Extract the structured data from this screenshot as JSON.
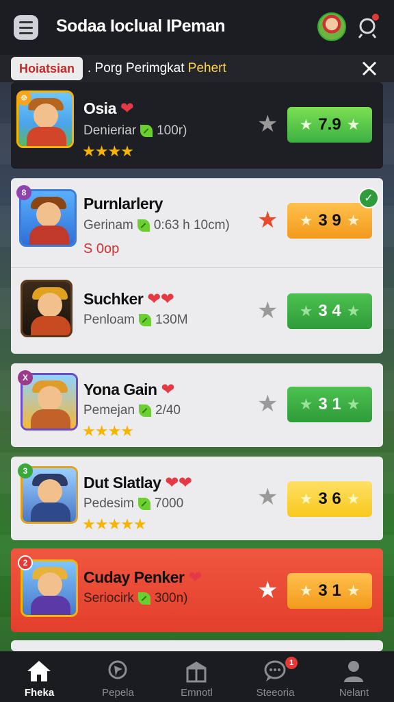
{
  "header": {
    "title": "Sodaa Ioclual IPeman",
    "menu_icon": "menu-icon",
    "avatar_icon": "avatar-icon",
    "notification_icon": "bell-icon"
  },
  "banner": {
    "badge": "Hoiatsian",
    "text_prefix": ". Porg Perimgkat",
    "text_highlight": "Pehert",
    "close_icon": "close-icon"
  },
  "items": [
    {
      "name": "Osia",
      "hearts": "❤",
      "meta_label": "Denieriar",
      "meta_value": "100r)",
      "stars": "★★★★",
      "score": "7.9",
      "corner_badge": "☸",
      "theme": "dark"
    },
    {
      "name": "Purnlarlery",
      "meta_label": "Gerinam",
      "meta_value": "0:63 h 10cm)",
      "price": "S 0op",
      "score": "3 9",
      "corner_badge": "8",
      "theme": "light"
    },
    {
      "name": "Suchker",
      "hearts": "❤❤",
      "meta_label": "Penloam",
      "meta_value": "130M",
      "score": "3 4",
      "theme": "light"
    },
    {
      "name": "Yona Gain",
      "hearts": "❤",
      "meta_label": "Pemejan",
      "meta_value": "2/40",
      "stars": "★★★★",
      "score": "3 1",
      "corner_badge": "X",
      "theme": "light"
    },
    {
      "name": "Dut Slatlay",
      "hearts": "❤❤",
      "meta_label": "Pedesim",
      "meta_value": "7000",
      "stars": "★★★★★",
      "score": "3 6",
      "corner_badge": "3",
      "theme": "light"
    },
    {
      "name": "Cuday Penker",
      "hearts": "❤",
      "meta_label": "Seriocirk",
      "meta_value": "300n)",
      "score": "3 1",
      "corner_badge": "2",
      "theme": "red"
    }
  ],
  "nav": [
    {
      "label": "Fheka",
      "icon": "home-icon",
      "active": true
    },
    {
      "label": "Pepela",
      "icon": "pin-icon"
    },
    {
      "label": "Emnotl",
      "icon": "store-icon"
    },
    {
      "label": "Steeoria",
      "icon": "chat-icon",
      "badge": "1"
    },
    {
      "label": "Nelant",
      "icon": "profile-icon"
    }
  ],
  "colors": {
    "score_green": "#3cb043",
    "score_orange": "#f7a51c",
    "score_yellow": "#f7c81c",
    "highlight_red": "#e84b3c",
    "heart": "#e53945",
    "star_gold": "#f7b500"
  }
}
